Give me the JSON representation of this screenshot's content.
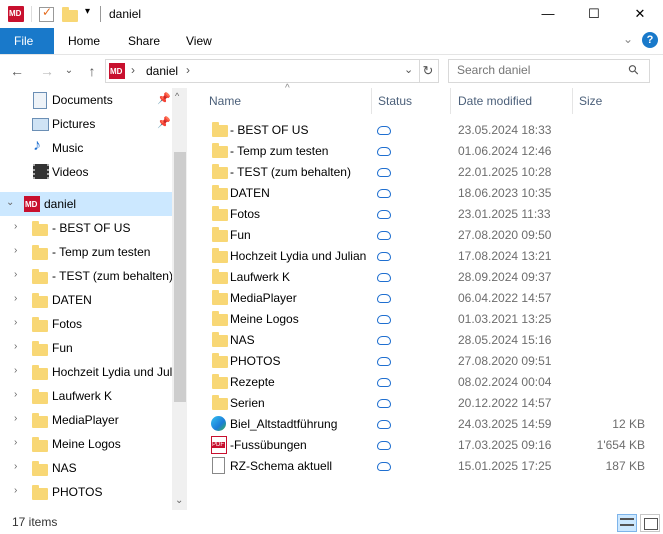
{
  "window": {
    "title": "daniel",
    "minimize_glyph": "—",
    "maximize_glyph": "☐",
    "close_glyph": "✕"
  },
  "ribbon": {
    "tabs": [
      "File",
      "Home",
      "Share",
      "View"
    ],
    "expand_glyph": "⌄",
    "help_glyph": "?"
  },
  "address": {
    "path_label": "daniel",
    "sep_glyph": "›",
    "dropdown_glyph": "⌄",
    "refresh_glyph": "↻",
    "back_glyph": "←",
    "forward_glyph": "→",
    "recent_glyph": "⌄",
    "up_glyph": "↑"
  },
  "search": {
    "placeholder": "Search daniel",
    "icon_glyph": "⚲"
  },
  "nav_pane": {
    "quick_access": [
      {
        "label": "Documents",
        "icon": "documents-icon",
        "pinned": true
      },
      {
        "label": "Pictures",
        "icon": "pictures-icon",
        "pinned": true
      },
      {
        "label": "Music",
        "icon": "music-icon",
        "pinned": false
      },
      {
        "label": "Videos",
        "icon": "videos-icon",
        "pinned": false
      }
    ],
    "root": {
      "label": "daniel",
      "icon": "user-md-icon",
      "selected": true
    },
    "children": [
      "- BEST OF US",
      "- Temp zum testen",
      "- TEST (zum behalten)",
      "DATEN",
      "Fotos",
      "Fun",
      "Hochzeit Lydia und Jul",
      "Laufwerk K",
      "MediaPlayer",
      "Meine Logos",
      "NAS",
      "PHOTOS"
    ]
  },
  "columns": {
    "name": "Name",
    "status": "Status",
    "date": "Date modified",
    "size": "Size",
    "sort_glyph": "^"
  },
  "files": [
    {
      "name": "- BEST OF US",
      "type": "folder",
      "date": "23.05.2024 18:33",
      "size": ""
    },
    {
      "name": "- Temp zum testen",
      "type": "folder",
      "date": "01.06.2024 12:46",
      "size": ""
    },
    {
      "name": "- TEST (zum behalten)",
      "type": "folder",
      "date": "22.01.2025 10:28",
      "size": ""
    },
    {
      "name": "DATEN",
      "type": "folder",
      "date": "18.06.2023 10:35",
      "size": ""
    },
    {
      "name": "Fotos",
      "type": "folder",
      "date": "23.01.2025 11:33",
      "size": ""
    },
    {
      "name": "Fun",
      "type": "folder",
      "date": "27.08.2020 09:50",
      "size": ""
    },
    {
      "name": "Hochzeit Lydia und Julian",
      "type": "folder",
      "date": "17.08.2024 13:21",
      "size": ""
    },
    {
      "name": "Laufwerk K",
      "type": "folder",
      "date": "28.09.2024 09:37",
      "size": ""
    },
    {
      "name": "MediaPlayer",
      "type": "folder",
      "date": "06.04.2022 14:57",
      "size": ""
    },
    {
      "name": "Meine Logos",
      "type": "folder",
      "date": "01.03.2021 13:25",
      "size": ""
    },
    {
      "name": "NAS",
      "type": "folder",
      "date": "28.05.2024 15:16",
      "size": ""
    },
    {
      "name": "PHOTOS",
      "type": "folder",
      "date": "27.08.2020 09:51",
      "size": ""
    },
    {
      "name": "Rezepte",
      "type": "folder",
      "date": "08.02.2024 00:04",
      "size": ""
    },
    {
      "name": "Serien",
      "type": "folder",
      "date": "20.12.2022 14:57",
      "size": ""
    },
    {
      "name": "Biel_Altstadtführung",
      "type": "edge",
      "date": "24.03.2025 14:59",
      "size": "12 KB"
    },
    {
      "name": "-Fussübungen",
      "type": "pdf",
      "date": "17.03.2025 09:16",
      "size": "1'654 KB"
    },
    {
      "name": "RZ-Schema aktuell",
      "type": "doc",
      "date": "15.01.2025 17:25",
      "size": "187 KB"
    }
  ],
  "status_bar": {
    "item_count": "17 items"
  },
  "icons": {
    "pdf_label": "PDF",
    "md_label": "MD"
  },
  "colors": {
    "accent": "#1979ca",
    "folder": "#f8d775",
    "cloud": "#1f6fd0",
    "selected": "#cce8ff"
  }
}
